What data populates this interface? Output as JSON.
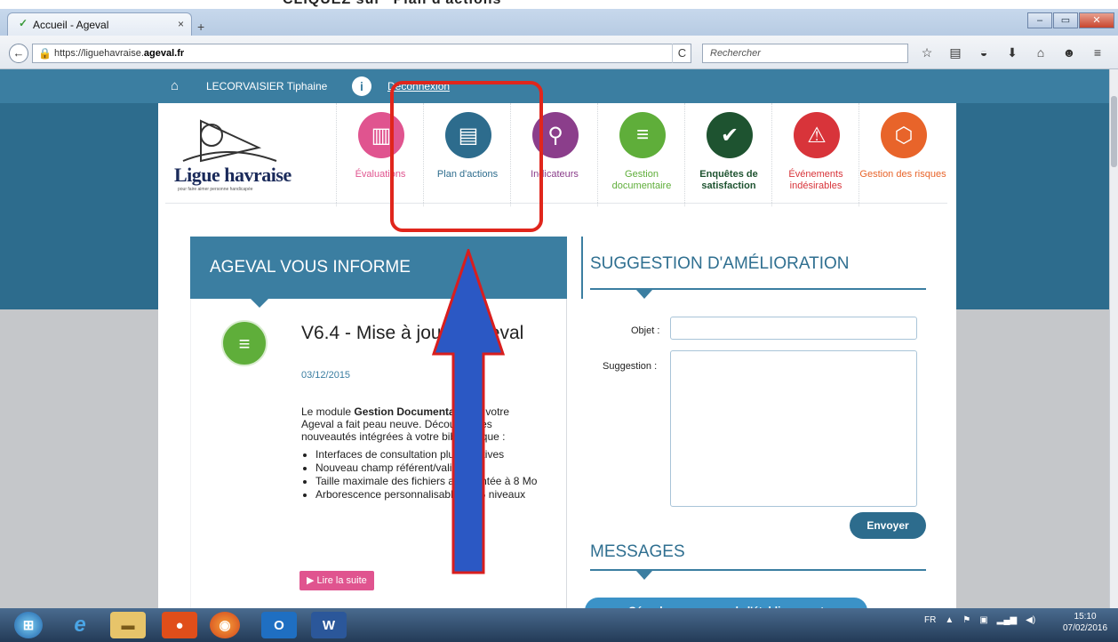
{
  "document_strip": {
    "text": "CLIQUEZ sur  \"Plan d'actions\""
  },
  "browser": {
    "tab_title": "Accueil - Ageval",
    "tab_close": "×",
    "new_tab": "+",
    "window_buttons": [
      "–",
      "▭",
      "✕"
    ],
    "back": "←",
    "url_prefix": "https://liguehavraise.",
    "url_domain": "ageval.fr",
    "reload": "C",
    "search_placeholder": "Rechercher",
    "toolbar_icons": [
      "star-icon",
      "bookmark-list-icon",
      "pocket-icon",
      "download-icon",
      "home-icon",
      "chat-icon",
      "menu-icon"
    ]
  },
  "header": {
    "user_name": "LECORVAISIER Tiphaine",
    "info": "i",
    "logout": "Déconnexion"
  },
  "logo": {
    "title": "Ligue havraise",
    "tagline": "pour faire aimer personne handicapée"
  },
  "modules": [
    {
      "label": "Évaluations",
      "color": "#e0548f",
      "icon": "▥"
    },
    {
      "label": "Plan d'actions",
      "color": "#2d6c8d",
      "icon": "▤"
    },
    {
      "label": "Indicateurs",
      "color": "#8b3e8b",
      "icon": "⚲"
    },
    {
      "label": "Gestion documentaire",
      "color": "#5fae3a",
      "icon": "≡"
    },
    {
      "label": "Enquêtes de satisfaction",
      "color": "#1e5330",
      "icon": "✔"
    },
    {
      "label": "Événements indésirables",
      "color": "#d8343a",
      "icon": "⚠"
    },
    {
      "label": "Gestion des risques",
      "color": "#e8642a",
      "icon": "⬡"
    }
  ],
  "news": {
    "section_title": "AGEVAL VOUS INFORME",
    "title": "V6.4 - Mise à jour d'Ageval",
    "date": "03/12/2015",
    "intro_1": "Le module ",
    "intro_bold": "Gestion Documentaire",
    "intro_2": " de votre Ageval a fait peau neuve. Découvrez les nouveautés intégrées à votre bibliothèque :",
    "bullets": [
      "Interfaces de consultation plus intuitives",
      "Nouveau champ référent/valideur",
      "Taille maximale des fichiers augmentée à 8 Mo",
      "Arborescence personnalisable sur 5 niveaux"
    ],
    "read_more": "▶ Lire la suite"
  },
  "suggestion": {
    "title": "SUGGESTION D'AMÉLIORATION",
    "object_label": "Objet :",
    "suggestion_label": "Suggestion :",
    "send": "Envoyer"
  },
  "messages": {
    "title": "MESSAGES",
    "button": "Gérer les messages de l'établissement"
  },
  "taskbar": {
    "lang": "FR",
    "time": "15:10",
    "date": "07/02/2016"
  }
}
